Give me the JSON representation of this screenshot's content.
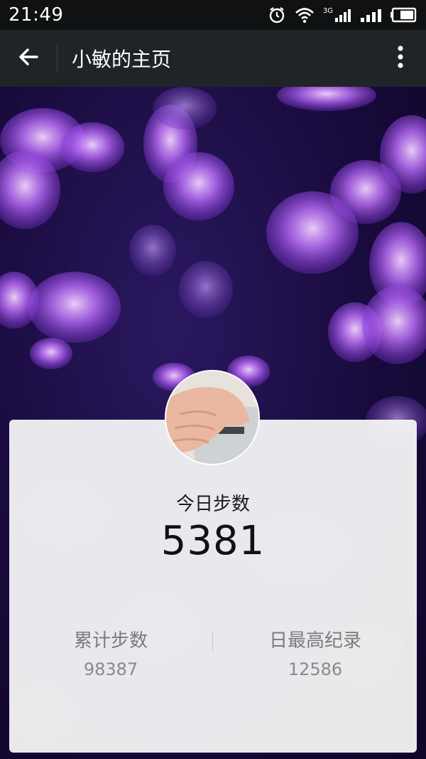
{
  "status_bar": {
    "time": "21:49",
    "icons": [
      "alarm-icon",
      "wifi-icon",
      "signal-3g-icon",
      "signal-icon",
      "battery-icon"
    ],
    "network_label": "3G"
  },
  "app_bar": {
    "back_icon": "arrow-left-icon",
    "title": "小敏的主页",
    "more_icon": "more-vertical-icon"
  },
  "hero": {
    "background": "jellyfish-photo"
  },
  "profile": {
    "avatar": "hand-on-keyboard-photo"
  },
  "stats_card": {
    "today_label": "今日步数",
    "today_value": "5381",
    "total_label": "累计步数",
    "total_value": "98387",
    "record_label": "日最高纪录",
    "record_value": "12586"
  },
  "colors": {
    "status_bar_bg": "#0f1112",
    "app_bar_bg": "#1f2527",
    "jellyfish_purple": "#b44cff",
    "card_bg": "#f4f4f6"
  }
}
